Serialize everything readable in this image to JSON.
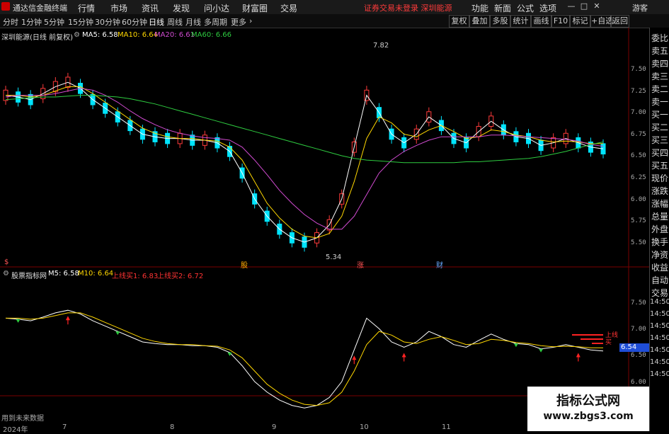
{
  "menubar": {
    "app_title": "通达信金融终端",
    "items": [
      "行情",
      "市场",
      "资讯",
      "发现",
      "问小达",
      "财富圈",
      "交易"
    ],
    "notice": "证券交易未登录  深圳能源",
    "right_items": [
      "功能",
      "新面",
      "公式",
      "选项"
    ],
    "window_buttons": [
      "—",
      "□",
      "✕"
    ],
    "guest": "游客"
  },
  "periodbar": {
    "periods": [
      "分时",
      "1分钟",
      "5分钟",
      "15分钟",
      "30分钟",
      "60分钟",
      "日线",
      "周线",
      "月线",
      "多周期",
      "更多"
    ],
    "active": "日线",
    "tools": [
      "复权",
      "叠加",
      "多股",
      "统计",
      "画线",
      "F10",
      "标记",
      "+自选",
      "返回"
    ]
  },
  "main_chart": {
    "stock": "深圳能源(日线 前复权)",
    "legend": [
      {
        "label": "MA5: 6.58",
        "color": "#ffffff"
      },
      {
        "label": "MA10: 6.64",
        "color": "#ffd700"
      },
      {
        "label": "MA20: 6.61",
        "color": "#d14bd1"
      },
      {
        "label": "MA60: 6.66",
        "color": "#2ecc40"
      }
    ],
    "high_label": "7.82",
    "low_label": "5.34",
    "yticks": [
      "7.50",
      "7.25",
      "7.00",
      "6.75",
      "6.50",
      "6.25",
      "6.00",
      "5.75",
      "5.50"
    ],
    "markers": [
      {
        "label": "$",
        "color": "#ff5555"
      },
      {
        "label": "股",
        "color": "#ffaa00"
      },
      {
        "label": "涨",
        "color": "#ff5555"
      },
      {
        "label": "财",
        "color": "#66aaff"
      }
    ]
  },
  "indicator": {
    "name": "股票指标网",
    "legend": [
      {
        "label": "M5: 6.58",
        "color": "#ffffff"
      },
      {
        "label": "M10: 6.64",
        "color": "#ffd700"
      },
      {
        "label": "上线买1: 6.83",
        "color": "#ff3333"
      },
      {
        "label": "上线买2: 6.72",
        "color": "#ff3333"
      }
    ],
    "yticks": [
      "7.50",
      "7.00",
      "6.50",
      "6.00"
    ],
    "right_labels": [
      "14:50",
      "14:50",
      "14:50",
      "14:50",
      "14:50",
      "14:50",
      "14:50"
    ],
    "price_badge": "6.54",
    "side_labels": [
      "上线",
      "买"
    ],
    "footer": "用到未来数据"
  },
  "date_axis": [
    "2024年",
    "7",
    "8",
    "9",
    "10",
    "11"
  ],
  "right_panel": [
    "委比",
    "卖五",
    "卖四",
    "卖三",
    "卖二",
    "卖一",
    "买一",
    "买二",
    "买三",
    "买四",
    "买五",
    "现价",
    "涨跌",
    "涨幅",
    "总量",
    "外盘",
    "换手",
    "净资",
    "收益",
    "自动",
    "交易"
  ],
  "watermark": {
    "title": "指标公式网",
    "url": "www.zbgs3.com"
  },
  "chart_data": {
    "type": "line",
    "title": "深圳能源(日线 前复权)",
    "ylim": [
      5.3,
      7.9
    ],
    "series": [
      {
        "name": "MA5",
        "values": [
          7.2,
          7.18,
          7.15,
          7.22,
          7.3,
          7.35,
          7.28,
          7.15,
          7.05,
          6.95,
          6.85,
          6.75,
          6.72,
          6.7,
          6.7,
          6.68,
          6.68,
          6.65,
          6.55,
          6.3,
          6.0,
          5.8,
          5.65,
          5.55,
          5.5,
          5.55,
          5.7,
          6.0,
          6.6,
          7.2,
          7.0,
          6.75,
          6.65,
          6.75,
          6.95,
          6.85,
          6.7,
          6.65,
          6.78,
          6.9,
          6.8,
          6.72,
          6.7,
          6.62,
          6.65,
          6.7,
          6.65,
          6.6,
          6.58
        ]
      },
      {
        "name": "MA10",
        "values": [
          7.2,
          7.2,
          7.18,
          7.2,
          7.25,
          7.3,
          7.3,
          7.22,
          7.12,
          7.02,
          6.92,
          6.82,
          6.76,
          6.72,
          6.7,
          6.7,
          6.68,
          6.67,
          6.6,
          6.45,
          6.2,
          5.95,
          5.78,
          5.65,
          5.57,
          5.55,
          5.6,
          5.8,
          6.2,
          6.7,
          6.95,
          6.88,
          6.75,
          6.72,
          6.8,
          6.85,
          6.78,
          6.7,
          6.72,
          6.8,
          6.78,
          6.74,
          6.72,
          6.68,
          6.66,
          6.67,
          6.66,
          6.64,
          6.64
        ]
      },
      {
        "name": "MA20",
        "values": [
          7.18,
          7.2,
          7.2,
          7.2,
          7.22,
          7.25,
          7.28,
          7.26,
          7.2,
          7.12,
          7.02,
          6.93,
          6.86,
          6.8,
          6.76,
          6.73,
          6.71,
          6.7,
          6.68,
          6.6,
          6.45,
          6.28,
          6.1,
          5.95,
          5.82,
          5.72,
          5.65,
          5.65,
          5.8,
          6.05,
          6.3,
          6.45,
          6.55,
          6.62,
          6.68,
          6.72,
          6.72,
          6.72,
          6.72,
          6.74,
          6.74,
          6.73,
          6.72,
          6.71,
          6.7,
          6.69,
          6.67,
          6.63,
          6.61
        ]
      },
      {
        "name": "MA60",
        "values": [
          7.15,
          7.16,
          7.17,
          7.18,
          7.18,
          7.19,
          7.2,
          7.2,
          7.19,
          7.18,
          7.16,
          7.13,
          7.1,
          7.06,
          7.02,
          6.98,
          6.94,
          6.9,
          6.86,
          6.82,
          6.78,
          6.74,
          6.7,
          6.66,
          6.62,
          6.58,
          6.54,
          6.5,
          6.47,
          6.45,
          6.44,
          6.43,
          6.42,
          6.42,
          6.42,
          6.42,
          6.42,
          6.43,
          6.43,
          6.44,
          6.45,
          6.46,
          6.47,
          6.49,
          6.52,
          6.55,
          6.59,
          6.63,
          6.66
        ]
      }
    ]
  }
}
